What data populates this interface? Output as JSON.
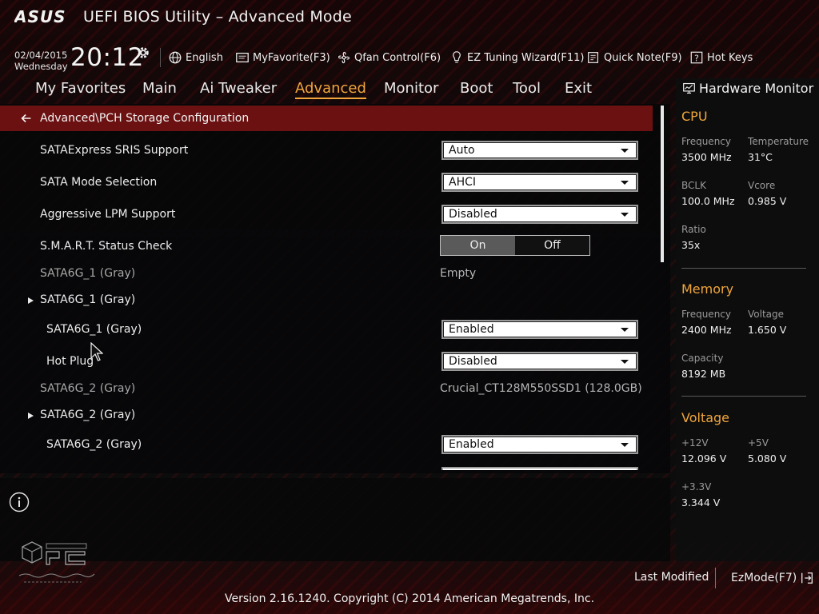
{
  "header": {
    "brand": "ASUS",
    "title": "UEFI BIOS Utility – Advanced Mode",
    "date": "02/04/2015",
    "weekday": "Wednesday",
    "time": "20:12",
    "tools": [
      {
        "label": "English",
        "icon": "globe-icon"
      },
      {
        "label": "MyFavorite(F3)",
        "icon": "favorite-icon"
      },
      {
        "label": "Qfan Control(F6)",
        "icon": "fan-icon"
      },
      {
        "label": "EZ Tuning Wizard(F11)",
        "icon": "bulb-icon"
      },
      {
        "label": "Quick Note(F9)",
        "icon": "note-icon"
      },
      {
        "label": "Hot Keys",
        "icon": "question-icon"
      }
    ]
  },
  "nav": {
    "items": [
      "My Favorites",
      "Main",
      "Ai Tweaker",
      "Advanced",
      "Monitor",
      "Boot",
      "Tool",
      "Exit"
    ],
    "active": "Advanced"
  },
  "breadcrumb": "Advanced\\PCH Storage Configuration",
  "settings": [
    {
      "label": "SATAExpress SRIS Support",
      "control": "dropdown",
      "value": "Auto"
    },
    {
      "label": "SATA Mode Selection",
      "control": "dropdown",
      "value": "AHCI"
    },
    {
      "label": "Aggressive LPM Support",
      "control": "dropdown",
      "value": "Disabled"
    },
    {
      "label": "S.M.A.R.T. Status Check",
      "control": "toggle",
      "on_label": "On",
      "off_label": "Off",
      "selected": "On"
    },
    {
      "label": "SATA6G_1 (Gray)",
      "control": "info",
      "value": "Empty"
    },
    {
      "label": "SATA6G_1 (Gray)",
      "control": "submenu"
    },
    {
      "label": "SATA6G_1 (Gray)",
      "control": "dropdown",
      "value": "Enabled"
    },
    {
      "label": "Hot Plug",
      "control": "dropdown",
      "value": "Disabled"
    },
    {
      "label": "SATA6G_2 (Gray)",
      "control": "info",
      "value": "Crucial_CT128M550SSD1 (128.0GB)"
    },
    {
      "label": "SATA6G_2 (Gray)",
      "control": "submenu"
    },
    {
      "label": "SATA6G_2 (Gray)",
      "control": "dropdown",
      "value": "Enabled"
    }
  ],
  "hardware_monitor": {
    "title": "Hardware Monitor",
    "cpu": {
      "heading": "CPU",
      "frequency_label": "Frequency",
      "frequency": "3500 MHz",
      "temperature_label": "Temperature",
      "temperature": "31°C",
      "bclk_label": "BCLK",
      "bclk": "100.0 MHz",
      "vcore_label": "Vcore",
      "vcore": "0.985 V",
      "ratio_label": "Ratio",
      "ratio": "35x"
    },
    "memory": {
      "heading": "Memory",
      "frequency_label": "Frequency",
      "frequency": "2400 MHz",
      "voltage_label": "Voltage",
      "voltage": "1.650 V",
      "capacity_label": "Capacity",
      "capacity": "8192 MB"
    },
    "voltage": {
      "heading": "Voltage",
      "v12_label": "+12V",
      "v12": "12.096 V",
      "v5_label": "+5V",
      "v5": "5.080 V",
      "v33_label": "+3.3V",
      "v33": "3.344 V"
    }
  },
  "footer": {
    "last_modified": "Last Modified",
    "ezmode": "EzMode(F7)",
    "copyright": "Version 2.16.1240. Copyright (C) 2014 American Megatrends, Inc."
  },
  "colors": {
    "accent": "#f0a63b",
    "breadcrumb_bg": "#6b1111"
  }
}
